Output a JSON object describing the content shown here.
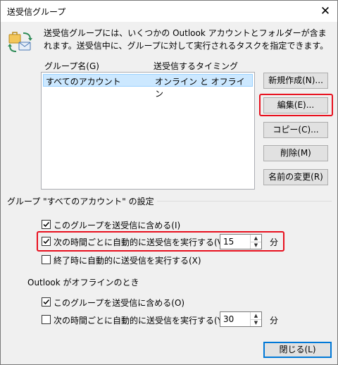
{
  "window": {
    "title": "送受信グループ",
    "close_glyph": "✕"
  },
  "description": "送受信グループには、いくつかの Outlook アカウントとフォルダーが含まれます。送受信中に、グループに対して実行されるタスクを指定できます。",
  "icons": {
    "main": "send-receive-icon"
  },
  "list": {
    "col_group": "グループ名(G)",
    "col_timing": "送受信するタイミング",
    "rows": [
      {
        "name": "すべてのアカウント",
        "timing": "オンライン と オフライン"
      }
    ]
  },
  "buttons": {
    "new": "新規作成(N)...",
    "edit": "編集(E)...",
    "copy": "コピー(C)...",
    "delete": "削除(M)",
    "rename": "名前の変更(R)",
    "close": "閉じる(L)"
  },
  "group_settings": {
    "title": "グループ \"すべてのアカウント\" の設定",
    "online": {
      "include_label": "このグループを送受信に含める(I)",
      "include_checked": true,
      "auto_label": "次の時間ごとに自動的に送受信を実行する(V)",
      "auto_checked": true,
      "auto_minutes": "15",
      "unit": "分",
      "exit_label": "終了時に自動的に送受信を実行する(X)",
      "exit_checked": false
    },
    "offline_title": "Outlook がオフラインのとき",
    "offline": {
      "include_label": "このグループを送受信に含める(O)",
      "include_checked": true,
      "auto_label": "次の時間ごとに自動的に送受信を実行する(Y)",
      "auto_checked": false,
      "auto_minutes": "30",
      "unit": "分"
    }
  },
  "colors": {
    "highlight": "#e8101e",
    "selection": "#cce8ff",
    "accent": "#0078d7"
  }
}
